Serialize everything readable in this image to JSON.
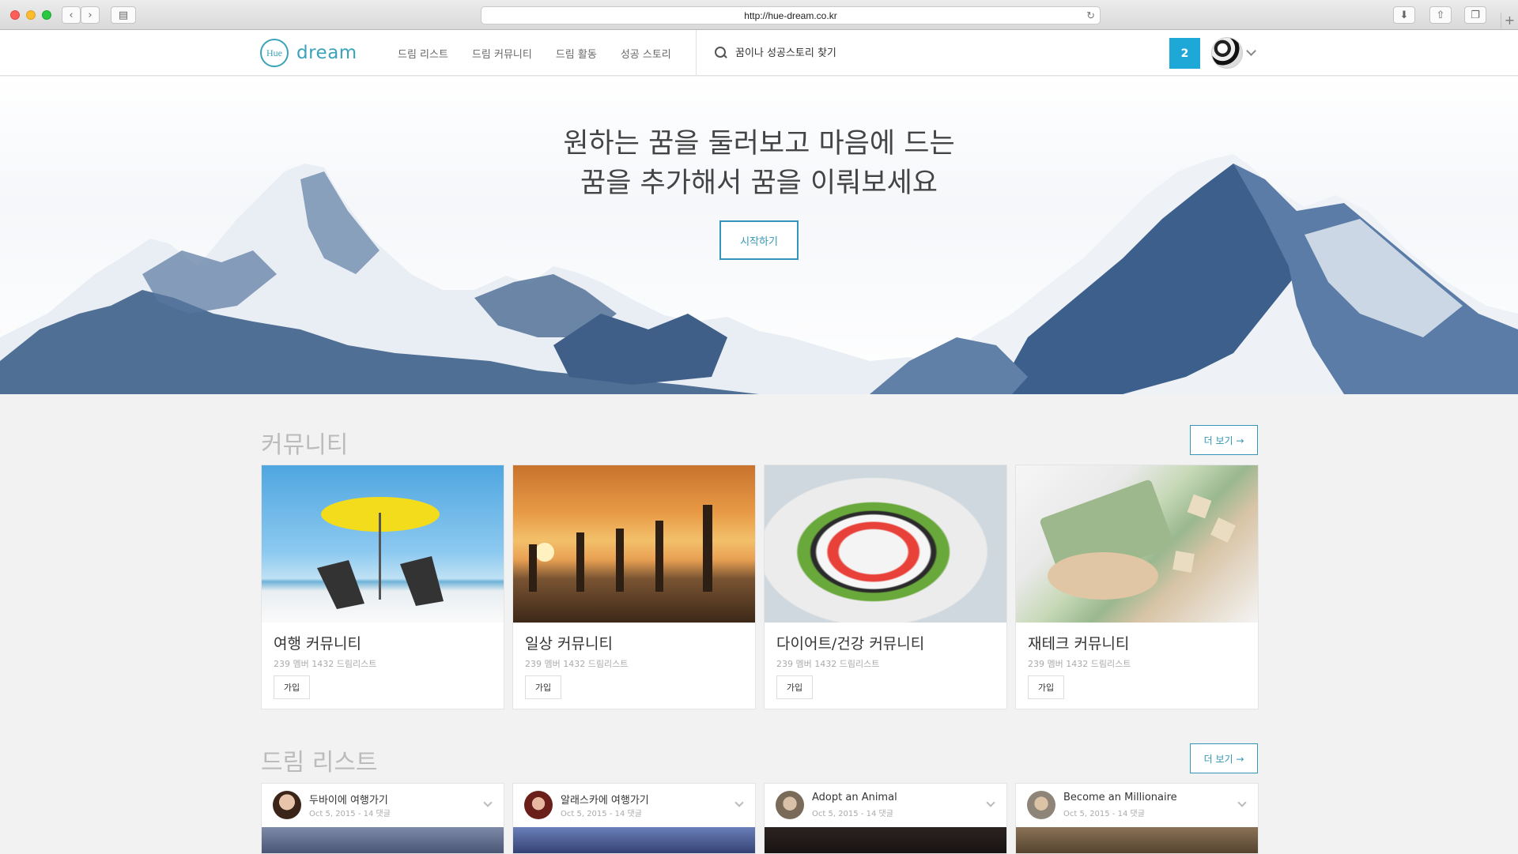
{
  "browser": {
    "url": "http://hue-dream.co.kr"
  },
  "header": {
    "logo_mark": "Hue",
    "logo_text": "dream",
    "nav": [
      "드림 리스트",
      "드림 커뮤니티",
      "드림 활동",
      "성공 스토리"
    ],
    "search_placeholder": "꿈이나 성공스토리 찾기",
    "notification_count": "2"
  },
  "hero": {
    "line1": "원하는 꿈을 둘러보고 마음에 드는",
    "line2": "꿈을 추가해서 꿈을 이뤄보세요",
    "cta": "시작하기"
  },
  "community": {
    "title": "커뮤니티",
    "more": "더 보기 →",
    "cards": [
      {
        "title": "여행 커뮤니티",
        "meta": "239 멤버 1432 드림리스트",
        "join": "가입",
        "image": "beach-umbrella-image"
      },
      {
        "title": "일상 커뮤니티",
        "meta": "239 멤버 1432 드림리스트",
        "join": "가입",
        "image": "beach-yoga-sunset-image"
      },
      {
        "title": "다이어트/건강 커뮤니티",
        "meta": "239 멤버 1432 드림리스트",
        "join": "가입",
        "image": "greek-salad-image"
      },
      {
        "title": "재테크 커뮤니티",
        "meta": "239 멤버 1432 드림리스트",
        "join": "가입",
        "image": "money-in-hand-image"
      }
    ]
  },
  "dreamlist": {
    "title": "드림 리스트",
    "more": "더 보기 →",
    "items": [
      {
        "title": "두바이에 여행가기",
        "meta": "Oct 5, 2015 - 14 댓글"
      },
      {
        "title": "알래스카에 여행가기",
        "meta": "Oct 5, 2015 - 14 댓글"
      },
      {
        "title": "Adopt an Animal",
        "meta": "Oct 5, 2015 - 14 댓글"
      },
      {
        "title": "Become an Millionaire",
        "meta": "Oct 5, 2015 - 14 댓글"
      }
    ]
  },
  "colors": {
    "accent": "#3496b6",
    "notification": "#1ea8d8"
  }
}
